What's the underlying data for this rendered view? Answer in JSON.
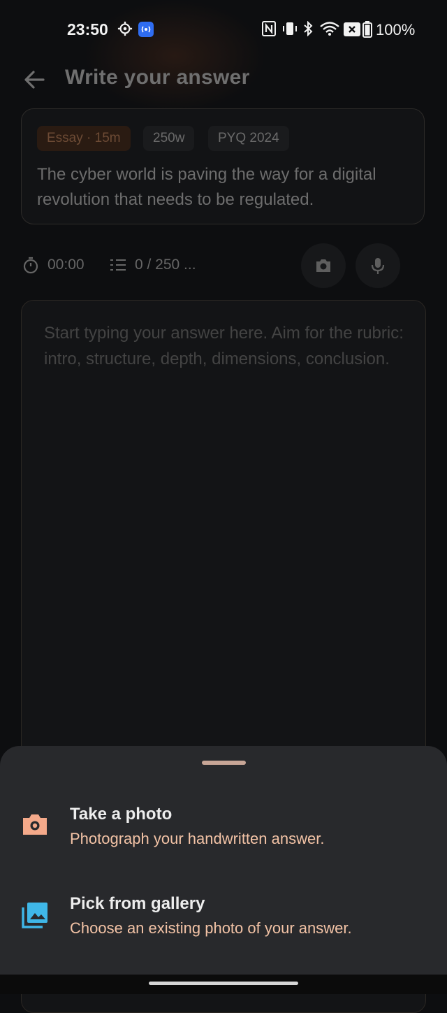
{
  "status_bar": {
    "time": "23:50",
    "battery": "100%",
    "icons": [
      "settings-gear-icon",
      "broadcast-icon",
      "nfc-icon",
      "vibrate-icon",
      "bluetooth-icon",
      "wifi-icon",
      "no-sim-icon",
      "battery-icon"
    ]
  },
  "header": {
    "title": "Write your answer",
    "back_icon": "arrow-left-icon"
  },
  "question": {
    "chips": [
      "Essay · 15m",
      "250w",
      "PYQ 2024"
    ],
    "text": "The cyber world is paving the way for a digital revolution that needs to be regulated."
  },
  "meta": {
    "timer": "00:00",
    "word_count": "0 / 250 ...",
    "camera_icon": "camera-icon",
    "mic_icon": "microphone-icon"
  },
  "answer": {
    "placeholder": "Start typing your answer here. Aim for the rubric: intro, structure, depth, dimensions, conclusion."
  },
  "sheet": {
    "options": [
      {
        "title": "Take a photo",
        "subtitle": "Photograph your handwritten answer.",
        "icon": "camera-icon",
        "color": "#f4a98a"
      },
      {
        "title": "Pick from gallery",
        "subtitle": "Choose an existing photo of your answer.",
        "icon": "gallery-icon",
        "color": "#3fb7e8"
      }
    ]
  },
  "colors": {
    "background": "#0d0e10",
    "sheet": "#28292c",
    "accent_peach": "#f3c3a6"
  }
}
